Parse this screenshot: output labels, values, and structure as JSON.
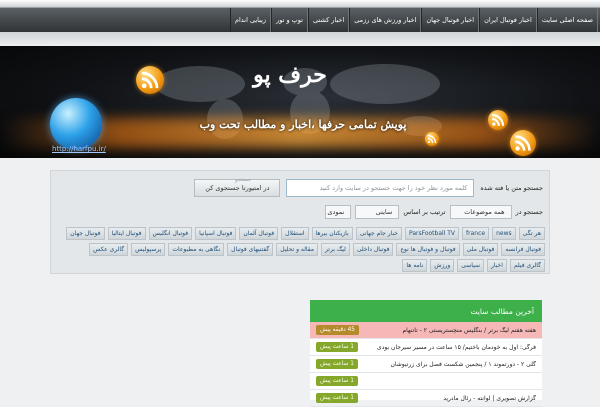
{
  "nav": {
    "items": [
      "صفحه اصلی سایت",
      "اخبار فوتبال ایران",
      "اخبار فوتبال جهان",
      "اخبار ورزش های رزمی",
      "اخبار کشتی",
      "توپ و تور",
      "زیبایی اندام"
    ]
  },
  "banner": {
    "title": "حرف پو",
    "subtitle": "پویش تمامی حرفها ،اخبار و مطالب تحت وب",
    "url": "http://harfpu.ir/"
  },
  "search": {
    "label": "جستجو متن یا فته شده",
    "placeholder": "کلمه مورد نظر خود را جهت جستجو در سایت وارد کنید",
    "tooltip": "جستجو",
    "button": "در امتیورتا جستجوی کن",
    "search_in_label": "جستجو در",
    "category": "همه موضوعات",
    "sort_label": "ترتیب بر اساس",
    "sort_value": "سایتی",
    "order_value": "نمودی"
  },
  "tags": [
    "هر تگی",
    "news",
    "france",
    "ParsFootball TV",
    "خبار جام جهانی",
    "بازیکنان بیرها",
    "استقلال",
    "فوتبال آلمان",
    "فوتبال اسپانیا",
    "فوتبال انگلیس",
    "فوتبال ایتالیا",
    "فوتبال جهان",
    "فوتبال فرانسه",
    "فوتبال ملی",
    "فوتبال و فوتبال ها نوع",
    "فوتبال داخلی",
    "لیگ برتر",
    "مقاله و تحلیل",
    "گفتنیهای فوتبال",
    "نگاهی به مطبوعات",
    "پرسپولیس",
    "گالری عکس",
    "گالری فیلم",
    "اخبار",
    "سیاسی",
    "ورزش",
    "نامه ها"
  ],
  "recent": {
    "title": "آخرین مطالب سایت",
    "items": [
      {
        "text": "هفته هفتم لیگ برتر / بنگلیس منچستریستی ۲ - تاتنهام",
        "time": "45 دقیقه پیش",
        "highlight": true
      },
      {
        "text": "فرگی: اول به خودمان باختیم/ ۱۵ ساعت در مسیر سیرجان بودی",
        "time": "1 ساعت پیش",
        "highlight": false
      },
      {
        "text": "گلی ۲ - دورتموند ۱ / پنجمین شکست فصل برای زرتیوشان",
        "time": "1 ساعت پیش",
        "highlight": false
      },
      {
        "text": "",
        "time": "1 ساعت پیش",
        "highlight": false
      },
      {
        "text": "گزارش تصویری | لوانته - رئال مادرید",
        "time": "1 ساعت پیش",
        "highlight": false
      }
    ]
  },
  "colors": {
    "accent": "#3db04a",
    "nav": "#3a3e42",
    "banner_glow": "#ff9a2a",
    "time_badge": "#86a82a"
  }
}
